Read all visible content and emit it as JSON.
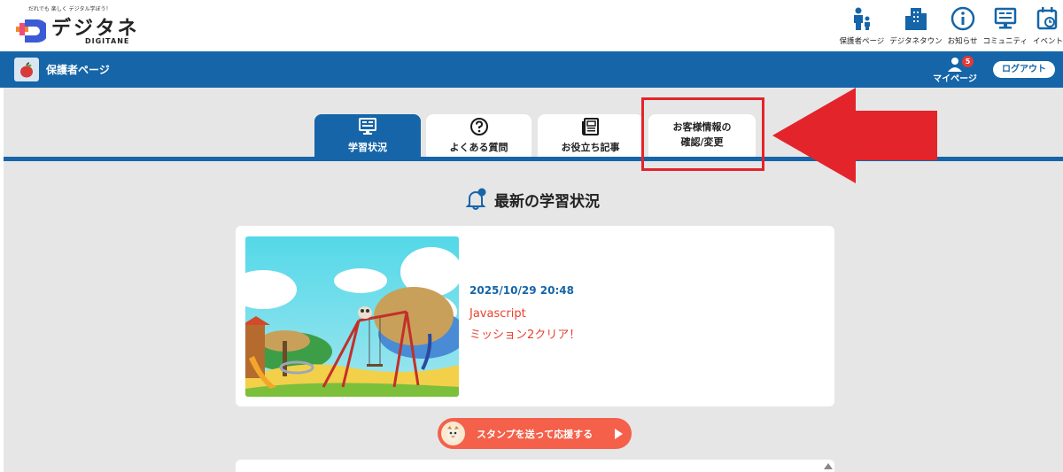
{
  "logo": {
    "tagline": "だれでも 楽しく デジタル学ぼう！",
    "name": "デジタネ",
    "subname": "DIGITANE"
  },
  "top_nav": {
    "items": [
      {
        "label": "保護者ページ",
        "icon": "parent-child-icon"
      },
      {
        "label": "デジタネタウン",
        "icon": "town-building-icon"
      },
      {
        "label": "お知らせ",
        "icon": "info-icon"
      },
      {
        "label": "コミュニティ",
        "icon": "monitor-icon"
      },
      {
        "label": "イベント",
        "icon": "calendar-icon"
      }
    ]
  },
  "blue_bar": {
    "title": "保護者ページ",
    "mypage_label": "マイページ",
    "notification_count": "5",
    "logout_label": "ログアウト"
  },
  "tabs": [
    {
      "label": "学習状況",
      "icon": "monitor-icon",
      "active": true
    },
    {
      "label": "よくある質問",
      "icon": "question-icon",
      "active": false
    },
    {
      "label": "お役立ち記事",
      "icon": "newspaper-icon",
      "active": false
    },
    {
      "label_line1": "お客様情報の",
      "label_line2": "確認/変更",
      "active": false
    }
  ],
  "section": {
    "title": "最新の学習状況",
    "icon": "bell-icon"
  },
  "card": {
    "date": "2025/10/29 20:48",
    "subject": "Javascript",
    "mission": "ミッション2クリア！"
  },
  "stamp_button": {
    "label": "スタンプを送って応援する"
  },
  "colors": {
    "brand_blue": "#1565a8",
    "accent_red": "#e3242b",
    "mission_red": "#e8412c",
    "stamp_button": "#f4604a",
    "background": "#e6e6e6"
  }
}
